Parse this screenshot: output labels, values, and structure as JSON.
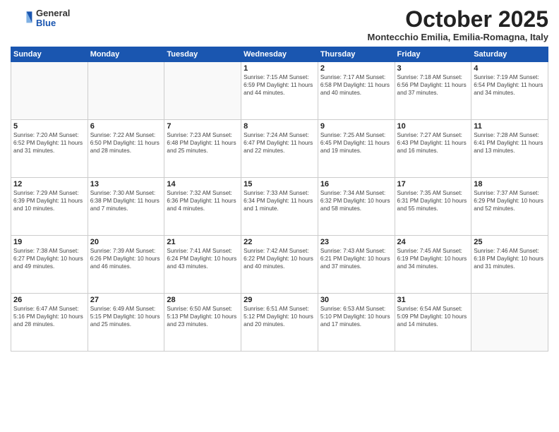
{
  "logo": {
    "general": "General",
    "blue": "Blue"
  },
  "title": "October 2025",
  "subtitle": "Montecchio Emilia, Emilia-Romagna, Italy",
  "days_header": [
    "Sunday",
    "Monday",
    "Tuesday",
    "Wednesday",
    "Thursday",
    "Friday",
    "Saturday"
  ],
  "weeks": [
    [
      {
        "day": "",
        "info": ""
      },
      {
        "day": "",
        "info": ""
      },
      {
        "day": "",
        "info": ""
      },
      {
        "day": "1",
        "info": "Sunrise: 7:15 AM\nSunset: 6:59 PM\nDaylight: 11 hours\nand 44 minutes."
      },
      {
        "day": "2",
        "info": "Sunrise: 7:17 AM\nSunset: 6:58 PM\nDaylight: 11 hours\nand 40 minutes."
      },
      {
        "day": "3",
        "info": "Sunrise: 7:18 AM\nSunset: 6:56 PM\nDaylight: 11 hours\nand 37 minutes."
      },
      {
        "day": "4",
        "info": "Sunrise: 7:19 AM\nSunset: 6:54 PM\nDaylight: 11 hours\nand 34 minutes."
      }
    ],
    [
      {
        "day": "5",
        "info": "Sunrise: 7:20 AM\nSunset: 6:52 PM\nDaylight: 11 hours\nand 31 minutes."
      },
      {
        "day": "6",
        "info": "Sunrise: 7:22 AM\nSunset: 6:50 PM\nDaylight: 11 hours\nand 28 minutes."
      },
      {
        "day": "7",
        "info": "Sunrise: 7:23 AM\nSunset: 6:48 PM\nDaylight: 11 hours\nand 25 minutes."
      },
      {
        "day": "8",
        "info": "Sunrise: 7:24 AM\nSunset: 6:47 PM\nDaylight: 11 hours\nand 22 minutes."
      },
      {
        "day": "9",
        "info": "Sunrise: 7:25 AM\nSunset: 6:45 PM\nDaylight: 11 hours\nand 19 minutes."
      },
      {
        "day": "10",
        "info": "Sunrise: 7:27 AM\nSunset: 6:43 PM\nDaylight: 11 hours\nand 16 minutes."
      },
      {
        "day": "11",
        "info": "Sunrise: 7:28 AM\nSunset: 6:41 PM\nDaylight: 11 hours\nand 13 minutes."
      }
    ],
    [
      {
        "day": "12",
        "info": "Sunrise: 7:29 AM\nSunset: 6:39 PM\nDaylight: 11 hours\nand 10 minutes."
      },
      {
        "day": "13",
        "info": "Sunrise: 7:30 AM\nSunset: 6:38 PM\nDaylight: 11 hours\nand 7 minutes."
      },
      {
        "day": "14",
        "info": "Sunrise: 7:32 AM\nSunset: 6:36 PM\nDaylight: 11 hours\nand 4 minutes."
      },
      {
        "day": "15",
        "info": "Sunrise: 7:33 AM\nSunset: 6:34 PM\nDaylight: 11 hours\nand 1 minute."
      },
      {
        "day": "16",
        "info": "Sunrise: 7:34 AM\nSunset: 6:32 PM\nDaylight: 10 hours\nand 58 minutes."
      },
      {
        "day": "17",
        "info": "Sunrise: 7:35 AM\nSunset: 6:31 PM\nDaylight: 10 hours\nand 55 minutes."
      },
      {
        "day": "18",
        "info": "Sunrise: 7:37 AM\nSunset: 6:29 PM\nDaylight: 10 hours\nand 52 minutes."
      }
    ],
    [
      {
        "day": "19",
        "info": "Sunrise: 7:38 AM\nSunset: 6:27 PM\nDaylight: 10 hours\nand 49 minutes."
      },
      {
        "day": "20",
        "info": "Sunrise: 7:39 AM\nSunset: 6:26 PM\nDaylight: 10 hours\nand 46 minutes."
      },
      {
        "day": "21",
        "info": "Sunrise: 7:41 AM\nSunset: 6:24 PM\nDaylight: 10 hours\nand 43 minutes."
      },
      {
        "day": "22",
        "info": "Sunrise: 7:42 AM\nSunset: 6:22 PM\nDaylight: 10 hours\nand 40 minutes."
      },
      {
        "day": "23",
        "info": "Sunrise: 7:43 AM\nSunset: 6:21 PM\nDaylight: 10 hours\nand 37 minutes."
      },
      {
        "day": "24",
        "info": "Sunrise: 7:45 AM\nSunset: 6:19 PM\nDaylight: 10 hours\nand 34 minutes."
      },
      {
        "day": "25",
        "info": "Sunrise: 7:46 AM\nSunset: 6:18 PM\nDaylight: 10 hours\nand 31 minutes."
      }
    ],
    [
      {
        "day": "26",
        "info": "Sunrise: 6:47 AM\nSunset: 5:16 PM\nDaylight: 10 hours\nand 28 minutes."
      },
      {
        "day": "27",
        "info": "Sunrise: 6:49 AM\nSunset: 5:15 PM\nDaylight: 10 hours\nand 25 minutes."
      },
      {
        "day": "28",
        "info": "Sunrise: 6:50 AM\nSunset: 5:13 PM\nDaylight: 10 hours\nand 23 minutes."
      },
      {
        "day": "29",
        "info": "Sunrise: 6:51 AM\nSunset: 5:12 PM\nDaylight: 10 hours\nand 20 minutes."
      },
      {
        "day": "30",
        "info": "Sunrise: 6:53 AM\nSunset: 5:10 PM\nDaylight: 10 hours\nand 17 minutes."
      },
      {
        "day": "31",
        "info": "Sunrise: 6:54 AM\nSunset: 5:09 PM\nDaylight: 10 hours\nand 14 minutes."
      },
      {
        "day": "",
        "info": ""
      }
    ]
  ]
}
